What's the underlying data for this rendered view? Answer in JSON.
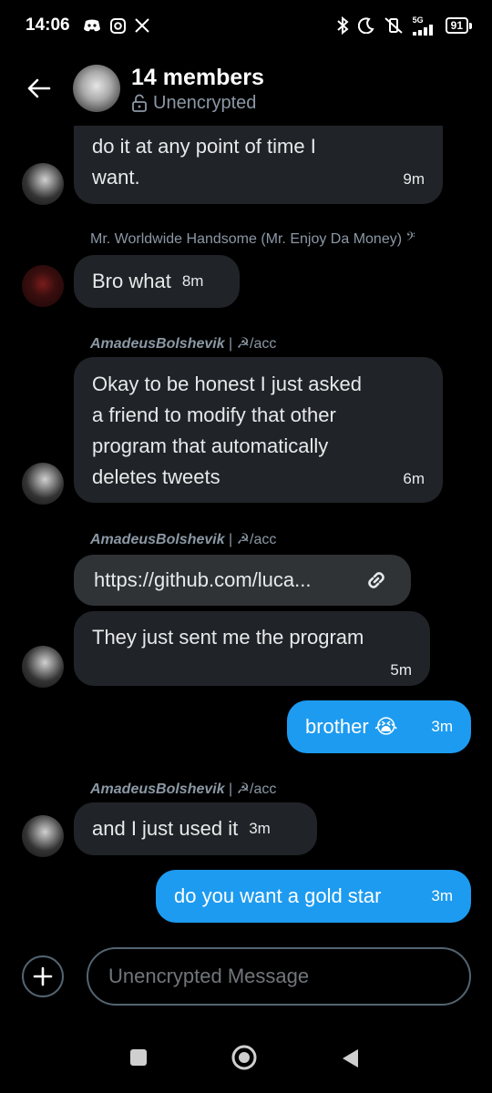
{
  "status_bar": {
    "time": "14:06",
    "network": "5G",
    "battery": "91"
  },
  "header": {
    "title": "14 members",
    "subtitle": "Unencrypted"
  },
  "messages": [
    {
      "text_line1": "do it at any point of time I",
      "text_line2": "want.",
      "time": "9m"
    },
    {
      "sender": "Mr. Worldwide Handsome (Mr. Enjoy Da Money) 𝄢",
      "text": "Bro what",
      "time": "8m"
    },
    {
      "sender_name": "AmadeusBolshevik",
      "sender_suffix": " | ☭/acc",
      "lines": [
        "Okay to be honest I just asked",
        "a friend to modify that other",
        "program that automatically",
        "deletes tweets"
      ],
      "time": "6m"
    },
    {
      "sender_name": "AmadeusBolshevik",
      "sender_suffix": " | ☭/acc",
      "link": "https://github.com/luca...",
      "text": "They just sent me the program",
      "time": "5m"
    },
    {
      "text": "brother 😭",
      "time": "3m"
    },
    {
      "sender_name": "AmadeusBolshevik",
      "sender_suffix": " | ☭/acc",
      "text": "and I just used it",
      "time": "3m"
    },
    {
      "text": "do you want a gold star",
      "time": "3m"
    }
  ],
  "composer": {
    "placeholder": "Unencrypted Message"
  },
  "colors": {
    "incoming_bubble": "#202327",
    "outgoing_bubble": "#1d9bf0",
    "link_bubble": "#2f3336",
    "muted_text": "#8b98a5"
  }
}
